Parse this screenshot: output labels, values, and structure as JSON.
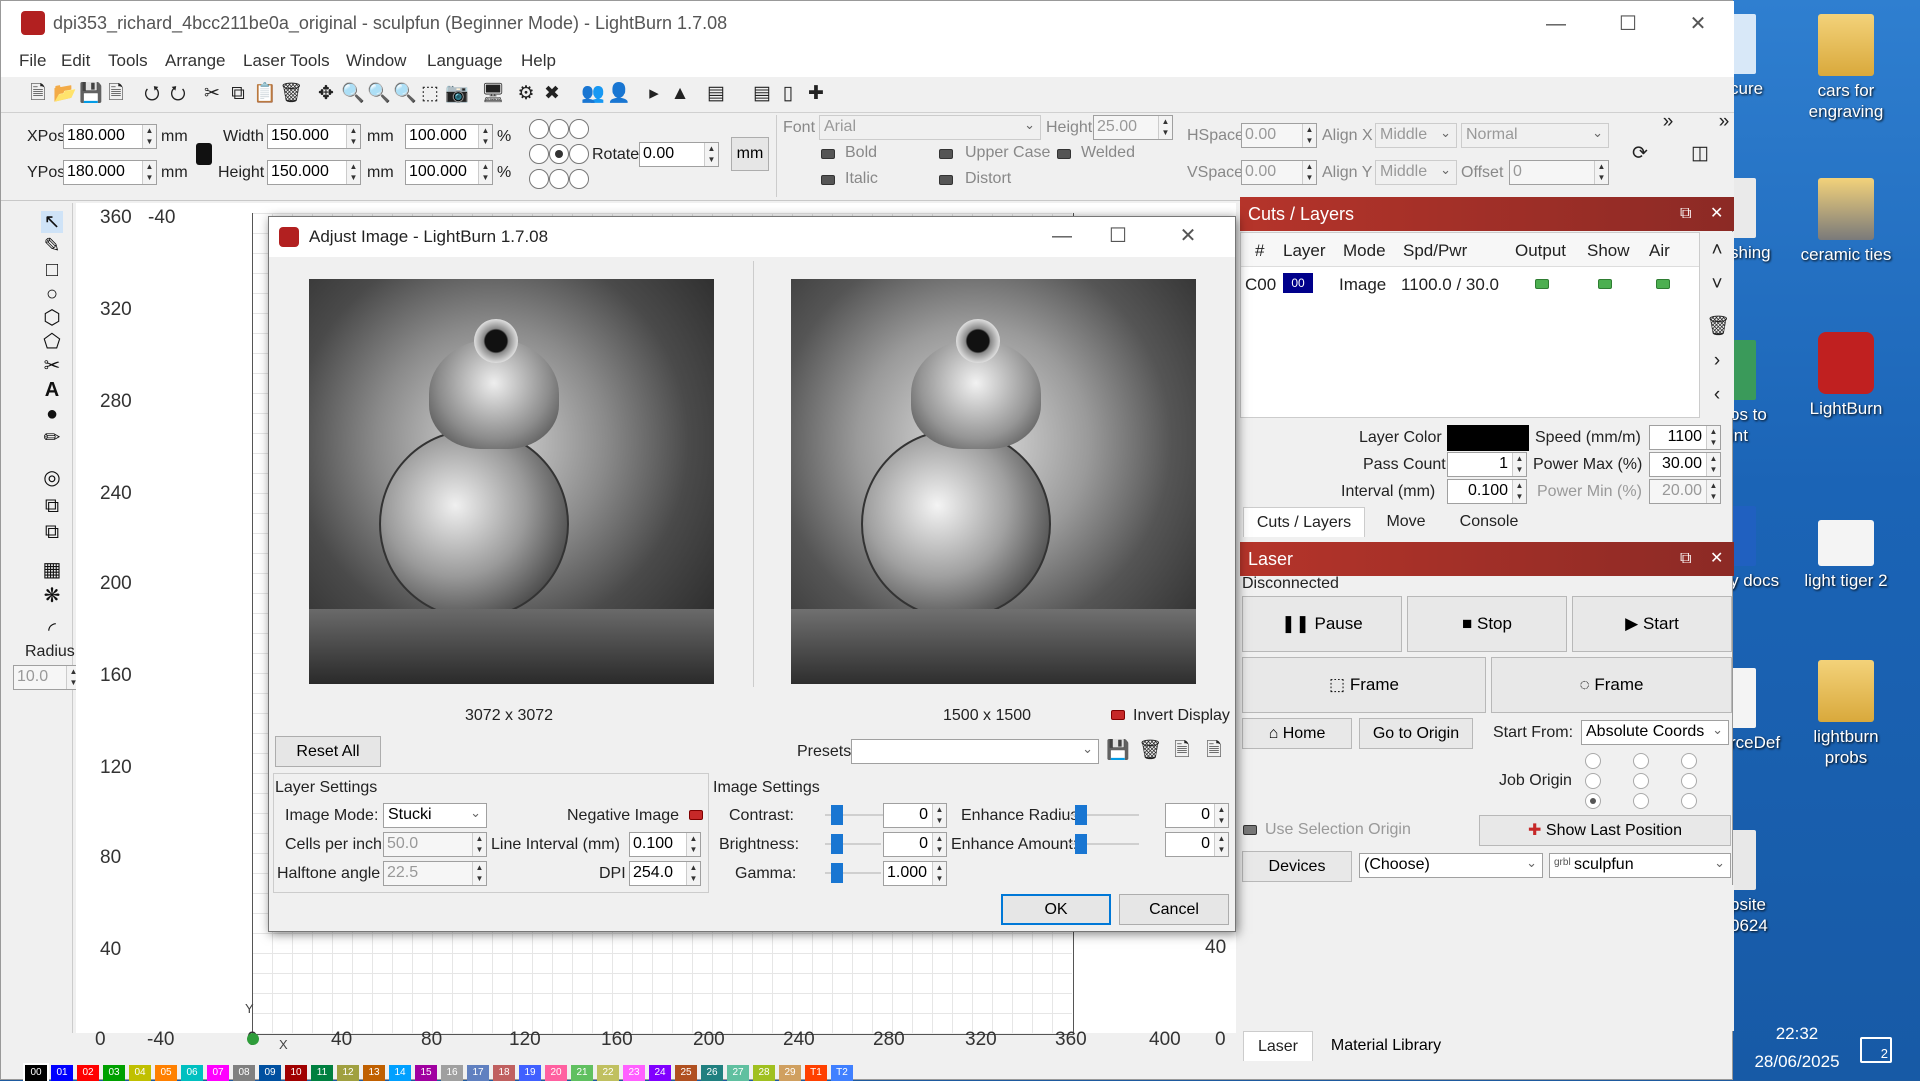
{
  "window": {
    "title": "dpi353_richard_4bcc211be0a_original - sculpfun (Beginner Mode) - LightBurn 1.7.08"
  },
  "menu": [
    "File",
    "Edit",
    "Tools",
    "Arrange",
    "Laser Tools",
    "Window",
    "Language",
    "Help"
  ],
  "props": {
    "xpos_label": "XPos",
    "xpos": "180.000",
    "ypos_label": "YPos",
    "ypos": "180.000",
    "unit": "mm",
    "width_label": "Width",
    "width": "150.000",
    "height_label": "Height",
    "height": "150.000",
    "width_pct": "100.000",
    "height_pct": "100.000",
    "pct": "%",
    "rotate_label": "Rotate",
    "rotate": "0.00",
    "mm_button": "mm",
    "font_label": "Font",
    "font": "Arial",
    "font_height_label": "Height",
    "font_height": "25.00",
    "bold": "Bold",
    "italic": "Italic",
    "upper_case": "Upper Case",
    "distort": "Distort",
    "welded": "Welded",
    "hspace_label": "HSpace",
    "hspace": "0.00",
    "vspace_label": "VSpace",
    "vspace": "0.00",
    "alignx_label": "Align X",
    "alignx": "Middle",
    "aligny_label": "Align Y",
    "aligny": "Middle",
    "normal": "Normal",
    "offset_label": "Offset",
    "offset": "0"
  },
  "ruler": {
    "y": [
      "360",
      "320",
      "280",
      "240",
      "200",
      "160",
      "120",
      "80",
      "40",
      "0"
    ],
    "x": [
      "-40",
      "0",
      "40",
      "80",
      "120",
      "160",
      "200",
      "240",
      "280",
      "320",
      "360",
      "400"
    ],
    "x_left_top": "-40",
    "right_40": "40",
    "right_0": "0",
    "axis_y": "Y",
    "axis_x": "X"
  },
  "radius": {
    "label": "Radius:",
    "value": "10.0"
  },
  "dialog": {
    "title": "Adjust Image - LightBurn 1.7.08",
    "orig_size": "3072 x 3072",
    "proc_size": "1500 x 1500",
    "invert_display": "Invert Display",
    "reset_all": "Reset All",
    "presets": "Presets",
    "layer_settings": "Layer Settings",
    "image_mode_label": "Image Mode:",
    "image_mode": "Stucki",
    "cells_label": "Cells per inch",
    "cells": "50.0",
    "halftone_label": "Halftone angle",
    "halftone": "22.5",
    "negative_label": "Negative Image",
    "line_interval_label": "Line Interval (mm)",
    "line_interval": "0.100",
    "dpi_label": "DPI",
    "dpi": "254.0",
    "image_settings": "Image Settings",
    "contrast_label": "Contrast:",
    "contrast": "0",
    "brightness_label": "Brightness:",
    "brightness": "0",
    "gamma_label": "Gamma:",
    "gamma": "1.000",
    "enh_radius_label": "Enhance Radius:",
    "enh_radius": "0",
    "enh_amount_label": "Enhance Amount:",
    "enh_amount": "0",
    "ok": "OK",
    "cancel": "Cancel"
  },
  "cuts": {
    "title": "Cuts / Layers",
    "headers": [
      "#",
      "Layer",
      "Mode",
      "Spd/Pwr",
      "Output",
      "Show",
      "Air"
    ],
    "row": {
      "id": "C00",
      "layer": "00",
      "mode": "Image",
      "spdpwr": "1100.0 / 30.0"
    },
    "layer_color_label": "Layer Color",
    "speed_label": "Speed (mm/m)",
    "speed": "1100",
    "pass_label": "Pass Count",
    "pass": "1",
    "powermax_label": "Power Max (%)",
    "powermax": "30.00",
    "interval_label": "Interval (mm)",
    "interval": "0.100",
    "powermin_label": "Power Min (%)",
    "powermin": "20.00",
    "tabs": [
      "Cuts / Layers",
      "Move",
      "Console"
    ]
  },
  "laser": {
    "title": "Laser",
    "status": "Disconnected",
    "pause": "Pause",
    "stop": "Stop",
    "start": "Start",
    "frame1": "Frame",
    "frame2": "Frame",
    "home": "Home",
    "goto": "Go to Origin",
    "start_from_label": "Start From:",
    "start_from": "Absolute Coords",
    "job_origin": "Job Origin",
    "use_sel": "Use Selection Origin",
    "show_last": "Show Last Position",
    "devices": "Devices",
    "choose": "(Choose)",
    "device": "sculpfun",
    "bottom_tabs": [
      "Laser",
      "Material Library"
    ]
  },
  "palette": [
    "00",
    "01",
    "02",
    "03",
    "04",
    "05",
    "06",
    "07",
    "08",
    "09",
    "10",
    "11",
    "12",
    "13",
    "14",
    "15",
    "16",
    "17",
    "18",
    "19",
    "20",
    "21",
    "22",
    "23",
    "24",
    "25",
    "26",
    "27",
    "28",
    "29",
    "T1",
    "T2"
  ],
  "palette_colors": [
    "#000000",
    "#0000ff",
    "#ff0000",
    "#00a000",
    "#c0c000",
    "#ff8000",
    "#00c0c0",
    "#ff00ff",
    "#808080",
    "#0050a0",
    "#a00000",
    "#008040",
    "#a0a040",
    "#c06000",
    "#00a0ff",
    "#a000a0",
    "#a0a0a0",
    "#6080c0",
    "#c06060",
    "#4060ff",
    "#ff60a0",
    "#60c060",
    "#c0c060",
    "#ff60ff",
    "#8000ff",
    "#b05020",
    "#208080",
    "#60c0a0",
    "#a0c020",
    "#d0a060",
    "#ff4000",
    "#4080ff"
  ],
  "desktop": {
    "peek": [
      "cure",
      "shing",
      "os to\nint",
      "y docs",
      "rceDef",
      "psite\n0624"
    ],
    "icons": [
      "cars for\nengraving",
      "ceramic ties",
      "LightBurn",
      "light tiger 2",
      "lightburn\nprobs"
    ]
  },
  "clock": {
    "time": "22:32",
    "date": "28/06/2025"
  },
  "notifications": "2"
}
